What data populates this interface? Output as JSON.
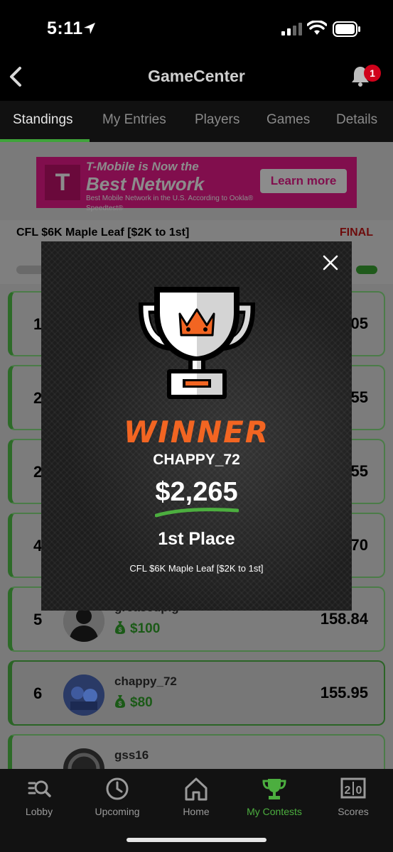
{
  "status_bar": {
    "time": "5:11"
  },
  "header": {
    "title": "GameCenter",
    "notification_count": "1"
  },
  "tabs": [
    {
      "label": "Standings",
      "active": true
    },
    {
      "label": "My Entries",
      "active": false
    },
    {
      "label": "Players",
      "active": false
    },
    {
      "label": "Games",
      "active": false
    },
    {
      "label": "Details",
      "active": false
    }
  ],
  "ad": {
    "headline_top": "T-Mobile is Now the",
    "headline_big": "Best Network",
    "subtext": "Best Mobile Network in the U.S. According to Ookla® Speedtest®",
    "cta": "Learn more",
    "logo": "T"
  },
  "contest": {
    "name": "CFL $6K Maple Leaf [$2K to 1st]",
    "status": "FINAL"
  },
  "standings": [
    {
      "rank": "1",
      "user": "",
      "prize": "",
      "score": "05"
    },
    {
      "rank": "2",
      "user": "",
      "prize": "",
      "score": "55"
    },
    {
      "rank": "2",
      "user": "",
      "prize": "",
      "score": "55"
    },
    {
      "rank": "4",
      "user": "",
      "prize": "",
      "score": "70"
    },
    {
      "rank": "5",
      "user": "greasedpig",
      "prize": "$100",
      "score": "158.84"
    },
    {
      "rank": "6",
      "user": "chappy_72",
      "prize": "$80",
      "score": "155.95"
    },
    {
      "rank": "",
      "user": "gss16",
      "prize": "",
      "score": ""
    }
  ],
  "modal": {
    "title": "WINNER",
    "username": "CHAPPY_72",
    "amount": "$2,265",
    "place": "1st Place",
    "contest": "CFL $6K Maple Leaf [$2K to 1st]"
  },
  "bottom_nav": [
    {
      "label": "Lobby",
      "icon": "lobby-search-icon"
    },
    {
      "label": "Upcoming",
      "icon": "clock-icon"
    },
    {
      "label": "Home",
      "icon": "home-icon"
    },
    {
      "label": "My Contests",
      "icon": "trophy-icon",
      "active": true
    },
    {
      "label": "Scores",
      "icon": "scoreboard-icon"
    }
  ],
  "colors": {
    "accent_green": "#4cae3f",
    "winner_orange": "#f26522",
    "final_red": "#d0021b"
  }
}
